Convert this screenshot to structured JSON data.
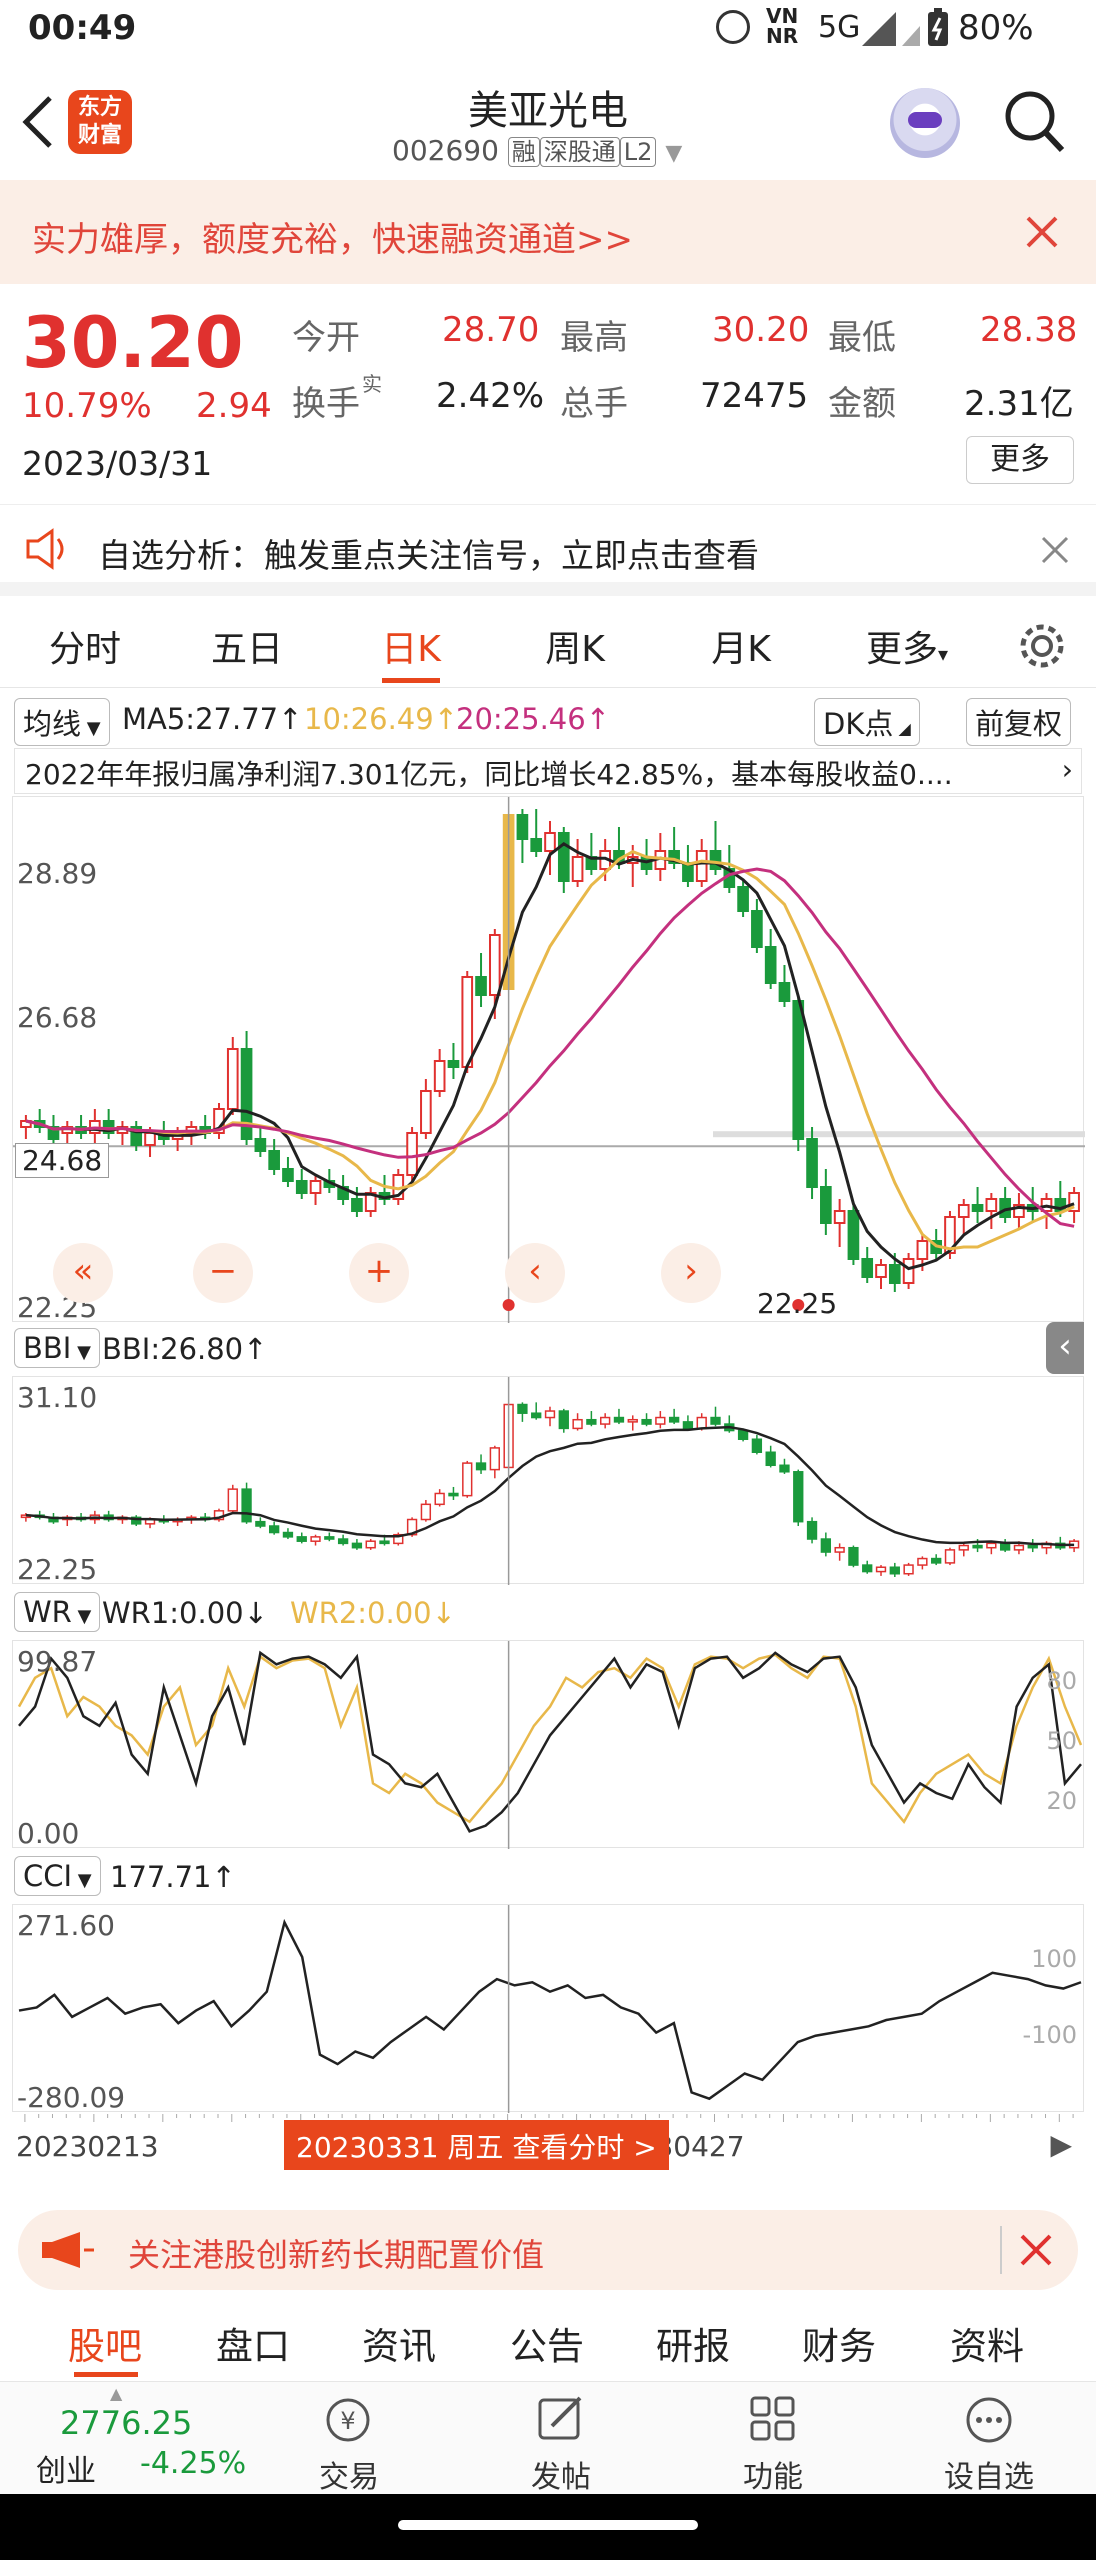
{
  "status": {
    "time": "00:49",
    "network": "5G",
    "nr": "VN NR",
    "battery": "80%"
  },
  "header": {
    "title": "美亚光电",
    "code": "002690",
    "tags": [
      "融",
      "深股通",
      "L2"
    ],
    "logo": "东方财富"
  },
  "promo": {
    "text": "实力雄厚，额度充裕，快速融资通道>>"
  },
  "quote": {
    "price": "30.20",
    "change_pct": "10.79%",
    "change": "2.94",
    "date": "2023/03/31",
    "open_label": "今开",
    "open": "28.70",
    "high_label": "最高",
    "high": "30.20",
    "low_label": "最低",
    "low": "28.38",
    "turnover_label": "换手",
    "turnover_sup": "实",
    "turnover": "2.42%",
    "volume_label": "总手",
    "volume": "72475",
    "amount_label": "金额",
    "amount": "2.31亿",
    "more": "更多"
  },
  "analysis": {
    "label": "自选分析：",
    "text": "触发重点关注信号，立即点击查看"
  },
  "tabs": [
    "分时",
    "五日",
    "日K",
    "周K",
    "月K",
    "更多"
  ],
  "active_tab": "日K",
  "ma_bar": {
    "mode": "均线",
    "ma5": "MA5:27.77",
    "ma10": "10:26.49",
    "ma20": "20:25.46",
    "dk": "DK点",
    "adj": "前复权"
  },
  "news": {
    "text": "2022年年报归属净利润7.301亿元，同比增长42.85%，基本每股收益0...."
  },
  "main_chart": {
    "y_labels": [
      "28.89",
      "26.68",
      "24.68",
      "22.25"
    ],
    "low_label": "22.25",
    "controls": [
      "«",
      "−",
      "+",
      "‹",
      "›"
    ]
  },
  "bbi": {
    "name": "BBI",
    "value": "BBI:26.80",
    "max": "31.10",
    "min": "22.25"
  },
  "wr": {
    "name": "WR",
    "wr1": "WR1:0.00",
    "wr2": "WR2:0.00",
    "max": "99.87",
    "min": "0.00",
    "right_ticks": [
      "80",
      "50",
      "20"
    ]
  },
  "cci": {
    "name": "CCI",
    "value": "177.71",
    "max": "271.60",
    "min": "-280.09",
    "right_ticks": [
      "100",
      "-100"
    ]
  },
  "datebar": {
    "start": "20230213",
    "cursor": "20230331 周五 查看分时 >",
    "end": "20230427"
  },
  "banner": {
    "text": "关注港股创新药长期配置价值"
  },
  "bottom_tabs": [
    "股吧",
    "盘口",
    "资讯",
    "公告",
    "研报",
    "财务",
    "资料"
  ],
  "active_bottom": "股吧",
  "toolbar": {
    "index_value": "2776.25",
    "index_name": "创业",
    "index_change": "-4.25%",
    "items": [
      "交易",
      "发帖",
      "功能",
      "设自选"
    ]
  },
  "colors": {
    "up": "#e0312f",
    "down": "#1a9a3c",
    "ma5": "#222222",
    "ma10": "#e8b84a",
    "ma20": "#c4307e",
    "accent": "#e8461c"
  },
  "candles": [
    [
      25.0,
      25.2,
      24.8,
      25.1
    ],
    [
      25.1,
      25.3,
      24.9,
      25.0
    ],
    [
      25.0,
      25.2,
      24.7,
      24.8
    ],
    [
      24.9,
      25.1,
      24.6,
      25.0
    ],
    [
      25.0,
      25.2,
      24.8,
      24.9
    ],
    [
      24.9,
      25.3,
      24.7,
      25.1
    ],
    [
      25.1,
      25.3,
      24.8,
      24.9
    ],
    [
      24.9,
      25.1,
      24.7,
      25.0
    ],
    [
      25.0,
      25.1,
      24.6,
      24.7
    ],
    [
      24.7,
      25.0,
      24.5,
      24.9
    ],
    [
      24.9,
      25.1,
      24.7,
      24.8
    ],
    [
      24.8,
      25.0,
      24.6,
      24.9
    ],
    [
      24.9,
      25.1,
      24.7,
      25.0
    ],
    [
      25.0,
      25.2,
      24.8,
      24.9
    ],
    [
      24.9,
      25.4,
      24.8,
      25.3
    ],
    [
      25.3,
      26.5,
      25.2,
      26.3
    ],
    [
      26.3,
      26.6,
      24.7,
      24.8
    ],
    [
      24.8,
      25.0,
      24.5,
      24.6
    ],
    [
      24.6,
      24.8,
      24.2,
      24.3
    ],
    [
      24.3,
      24.5,
      24.0,
      24.1
    ],
    [
      24.1,
      24.3,
      23.8,
      23.9
    ],
    [
      23.9,
      24.2,
      23.7,
      24.1
    ],
    [
      24.1,
      24.3,
      23.9,
      24.0
    ],
    [
      24.0,
      24.2,
      23.7,
      23.8
    ],
    [
      23.8,
      24.0,
      23.5,
      23.6
    ],
    [
      23.6,
      24.0,
      23.5,
      23.9
    ],
    [
      23.9,
      24.2,
      23.7,
      23.8
    ],
    [
      23.8,
      24.3,
      23.7,
      24.2
    ],
    [
      24.2,
      25.0,
      24.1,
      24.9
    ],
    [
      24.9,
      25.8,
      24.8,
      25.6
    ],
    [
      25.6,
      26.3,
      25.5,
      26.1
    ],
    [
      26.1,
      26.4,
      25.8,
      26.0
    ],
    [
      26.0,
      27.6,
      25.9,
      27.5
    ],
    [
      27.5,
      27.9,
      27.0,
      27.2
    ],
    [
      27.2,
      28.3,
      26.8,
      28.2
    ],
    [
      27.3,
      30.2,
      27.3,
      30.2
    ],
    [
      30.2,
      30.3,
      29.4,
      29.8
    ],
    [
      29.8,
      30.3,
      29.5,
      29.6
    ],
    [
      29.6,
      30.1,
      29.2,
      29.9
    ],
    [
      29.9,
      30.0,
      28.9,
      29.1
    ],
    [
      29.1,
      29.8,
      29.0,
      29.5
    ],
    [
      29.5,
      29.9,
      29.2,
      29.3
    ],
    [
      29.3,
      29.8,
      29.1,
      29.6
    ],
    [
      29.6,
      30.0,
      29.3,
      29.4
    ],
    [
      29.4,
      29.7,
      29.0,
      29.5
    ],
    [
      29.5,
      29.8,
      29.2,
      29.3
    ],
    [
      29.3,
      29.9,
      29.1,
      29.6
    ],
    [
      29.6,
      30.0,
      29.3,
      29.4
    ],
    [
      29.4,
      29.7,
      29.0,
      29.1
    ],
    [
      29.1,
      29.8,
      29.0,
      29.6
    ],
    [
      29.6,
      30.1,
      29.2,
      29.3
    ],
    [
      29.3,
      29.7,
      28.9,
      29.0
    ],
    [
      29.0,
      29.1,
      28.5,
      28.6
    ],
    [
      28.6,
      28.8,
      27.9,
      28.0
    ],
    [
      28.0,
      28.3,
      27.3,
      27.4
    ],
    [
      27.4,
      27.7,
      27.0,
      27.1
    ],
    [
      27.1,
      27.2,
      24.6,
      24.8
    ],
    [
      24.8,
      25.0,
      23.8,
      24.0
    ],
    [
      24.0,
      24.3,
      23.2,
      23.4
    ],
    [
      23.4,
      23.8,
      23.0,
      23.6
    ],
    [
      23.6,
      23.7,
      22.7,
      22.8
    ],
    [
      22.8,
      23.0,
      22.4,
      22.5
    ],
    [
      22.5,
      22.8,
      22.3,
      22.7
    ],
    [
      22.7,
      22.9,
      22.25,
      22.4
    ],
    [
      22.4,
      22.9,
      22.3,
      22.8
    ],
    [
      22.8,
      23.2,
      22.6,
      23.1
    ],
    [
      23.1,
      23.3,
      22.8,
      22.9
    ],
    [
      22.9,
      23.6,
      22.8,
      23.5
    ],
    [
      23.5,
      23.8,
      23.2,
      23.7
    ],
    [
      23.7,
      24.0,
      23.4,
      23.6
    ],
    [
      23.6,
      23.9,
      23.3,
      23.8
    ],
    [
      23.8,
      24.0,
      23.4,
      23.5
    ],
    [
      23.5,
      23.9,
      23.3,
      23.7
    ],
    [
      23.7,
      24.0,
      23.4,
      23.6
    ],
    [
      23.6,
      23.9,
      23.3,
      23.8
    ],
    [
      23.8,
      24.1,
      23.5,
      23.6
    ],
    [
      23.6,
      24.0,
      23.4,
      23.9
    ]
  ],
  "wr1_series": [
    60,
    70,
    95,
    85,
    65,
    60,
    72,
    45,
    35,
    80,
    55,
    30,
    65,
    80,
    50,
    98,
    92,
    95,
    96,
    92,
    85,
    96,
    45,
    40,
    30,
    28,
    35,
    20,
    5,
    8,
    15,
    25,
    40,
    55,
    65,
    75,
    85,
    95,
    80,
    92,
    88,
    60,
    90,
    95,
    96,
    85,
    90,
    98,
    92,
    88,
    95,
    96,
    80,
    50,
    35,
    20,
    30,
    25,
    22,
    40,
    28,
    20,
    70,
    85,
    92,
    30,
    40
  ],
  "wr2_series": [
    70,
    85,
    90,
    65,
    75,
    70,
    60,
    55,
    45,
    70,
    80,
    50,
    60,
    90,
    70,
    96,
    90,
    94,
    95,
    90,
    60,
    80,
    30,
    25,
    35,
    30,
    20,
    15,
    10,
    20,
    30,
    45,
    60,
    70,
    85,
    80,
    88,
    90,
    85,
    95,
    90,
    70,
    92,
    96,
    95,
    90,
    95,
    97,
    90,
    85,
    96,
    95,
    70,
    30,
    20,
    10,
    25,
    35,
    40,
    45,
    35,
    30,
    60,
    80,
    95,
    70,
    50
  ],
  "cci_series": [
    -20,
    -10,
    30,
    -40,
    -10,
    20,
    -30,
    -10,
    0,
    -60,
    -20,
    10,
    -70,
    -20,
    40,
    260,
    150,
    -160,
    -190,
    -150,
    -170,
    -120,
    -80,
    -40,
    -80,
    -20,
    40,
    80,
    60,
    70,
    40,
    60,
    20,
    30,
    -10,
    -30,
    -90,
    -60,
    -280,
    -300,
    -260,
    -220,
    -240,
    -180,
    -120,
    -100,
    -90,
    -80,
    -70,
    -50,
    -40,
    -30,
    10,
    40,
    70,
    100,
    90,
    80,
    60,
    50,
    70
  ]
}
